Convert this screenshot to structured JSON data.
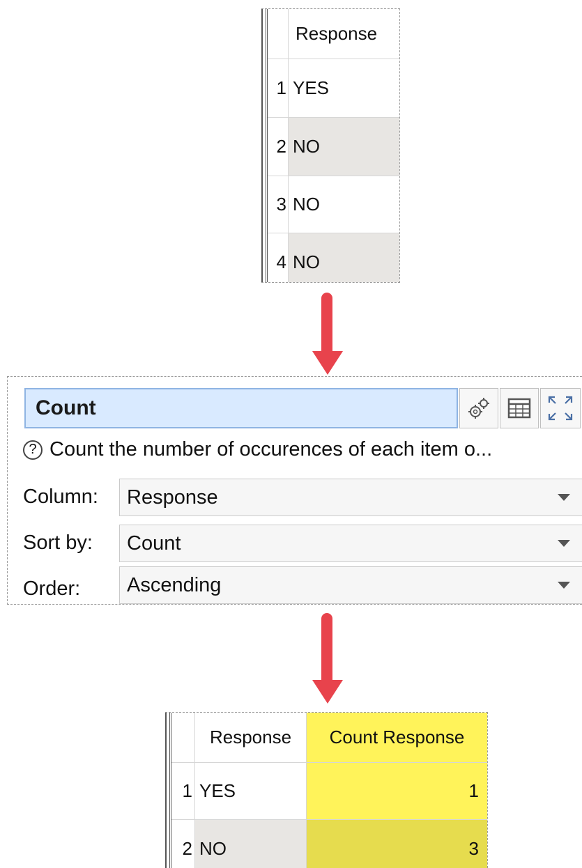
{
  "input_table": {
    "header": "Response",
    "rows": [
      {
        "index": "1",
        "value": "YES"
      },
      {
        "index": "2",
        "value": "NO"
      },
      {
        "index": "3",
        "value": "NO"
      },
      {
        "index": "4",
        "value": "NO"
      }
    ]
  },
  "node": {
    "title": "Count",
    "description": "Count the number of occurences of each item o...",
    "options": [
      {
        "label": "Column:",
        "value": "Response"
      },
      {
        "label": "Sort by:",
        "value": "Count"
      },
      {
        "label": "Order:",
        "value": "Ascending"
      }
    ],
    "toolbar_icons": [
      "settings-gears-icon",
      "table-view-icon",
      "expand-icon"
    ]
  },
  "output_table": {
    "headers": [
      "Response",
      "Count Response"
    ],
    "rows": [
      {
        "index": "1",
        "response": "YES",
        "count": "1"
      },
      {
        "index": "2",
        "response": "NO",
        "count": "3"
      }
    ]
  },
  "colors": {
    "arrow": "#e8434c",
    "title_bg": "#d9eaff",
    "highlight": "#fff35a",
    "alt_row": "#e8e6e3"
  }
}
